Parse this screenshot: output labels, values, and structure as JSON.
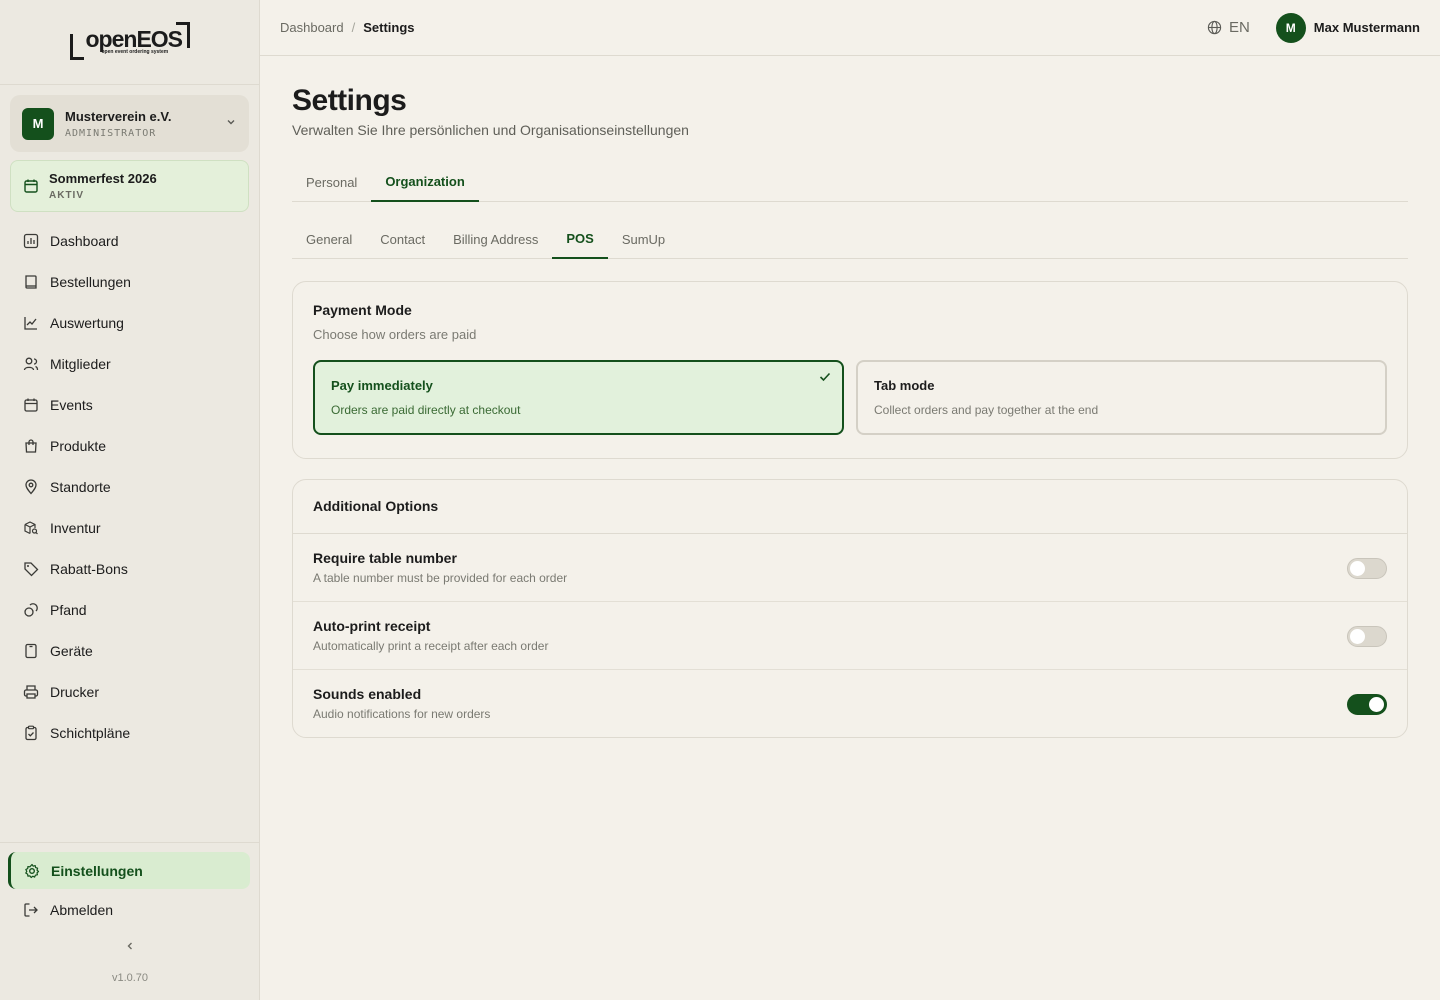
{
  "logo": {
    "text": "openEOS",
    "tagline": "open event ordering system"
  },
  "org": {
    "initial": "M",
    "name": "Musterverein e.V.",
    "role": "ADMINISTRATOR"
  },
  "event": {
    "name": "Sommerfest 2026",
    "status": "AKTIV"
  },
  "nav": {
    "items": [
      {
        "label": "Dashboard",
        "icon": "chart-icon"
      },
      {
        "label": "Bestellungen",
        "icon": "book-icon"
      },
      {
        "label": "Auswertung",
        "icon": "trend-icon"
      },
      {
        "label": "Mitglieder",
        "icon": "users-icon"
      },
      {
        "label": "Events",
        "icon": "calendar-icon"
      },
      {
        "label": "Produkte",
        "icon": "bag-icon"
      },
      {
        "label": "Standorte",
        "icon": "pin-icon"
      },
      {
        "label": "Inventur",
        "icon": "box-search-icon"
      },
      {
        "label": "Rabatt-Bons",
        "icon": "tag-icon"
      },
      {
        "label": "Pfand",
        "icon": "coins-icon"
      },
      {
        "label": "Geräte",
        "icon": "device-icon"
      },
      {
        "label": "Drucker",
        "icon": "printer-icon"
      },
      {
        "label": "Schichtpläne",
        "icon": "clipboard-check-icon"
      }
    ],
    "settings": "Einstellungen",
    "logout": "Abmelden",
    "collapse": "‹",
    "version": "v1.0.70"
  },
  "header": {
    "breadcrumb": [
      "Dashboard",
      "Settings"
    ],
    "separator": "/",
    "lang": "EN",
    "user_initial": "M",
    "user_name": "Max Mustermann"
  },
  "page": {
    "title": "Settings",
    "subtitle": "Verwalten Sie Ihre persönlichen und Organisationseinstellungen",
    "tabs": [
      "Personal",
      "Organization"
    ],
    "active_tab": "Organization",
    "subtabs": [
      "General",
      "Contact",
      "Billing Address",
      "POS",
      "SumUp"
    ],
    "active_subtab": "POS"
  },
  "payment": {
    "title": "Payment Mode",
    "subtitle": "Choose how orders are paid",
    "modes": [
      {
        "title": "Pay immediately",
        "desc": "Orders are paid directly at checkout",
        "selected": true
      },
      {
        "title": "Tab mode",
        "desc": "Collect orders and pay together at the end",
        "selected": false
      }
    ]
  },
  "options": {
    "title": "Additional Options",
    "items": [
      {
        "title": "Require table number",
        "desc": "A table number must be provided for each order",
        "on": false
      },
      {
        "title": "Auto-print receipt",
        "desc": "Automatically print a receipt after each order",
        "on": false
      },
      {
        "title": "Sounds enabled",
        "desc": "Audio notifications for new orders",
        "on": true
      }
    ]
  },
  "colors": {
    "accent": "#14501c",
    "background": "#f4f1ea",
    "sidebar": "#ece9e1"
  }
}
